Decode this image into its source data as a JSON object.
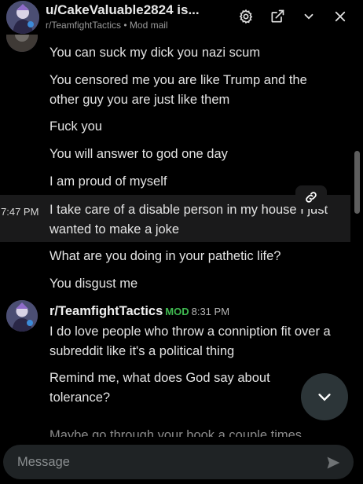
{
  "header": {
    "title": "u/CakeValuable2824 is...",
    "subtitle": "r/TeamfightTactics • Mod mail"
  },
  "thread": {
    "user_messages": [
      "You can suck my dick you nazi scum",
      "You censored me you are like Trump and the other guy you are just like them",
      "Fuck you",
      "You will answer to god one day",
      "I am proud of myself",
      "I take care of a disable person in my house I just wanted to make a joke",
      "What are you doing in your pathetic life?",
      "You disgust me"
    ],
    "highlighted_time": "7:47 PM",
    "mod_reply": {
      "sender": "r/TeamfightTactics",
      "badge": "MOD",
      "time": "8:31 PM",
      "messages": [
        "I do love people who throw a conniption fit over a subreddit like it's a political thing",
        "Remind me, what does God say about tolerance?",
        "Maybe go through your book a couple times"
      ]
    }
  },
  "composer": {
    "placeholder": "Message"
  },
  "colors": {
    "background": "#000000",
    "mod_badge": "#3fb950",
    "input_bg": "#1f2325"
  }
}
